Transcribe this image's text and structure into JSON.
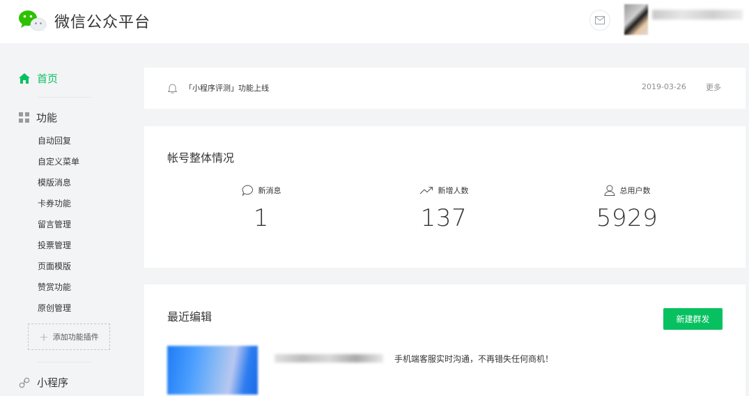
{
  "header": {
    "app_title": "微信公众平台"
  },
  "sidebar": {
    "home_label": "首页",
    "function_label": "功能",
    "function_items": [
      "自动回复",
      "自定义菜单",
      "模版消息",
      "卡券功能",
      "留言管理",
      "投票管理",
      "页面模版",
      "赞赏功能",
      "原创管理"
    ],
    "add_plugin_label": "添加功能插件",
    "mini_program_label": "小程序"
  },
  "notice": {
    "text": "「小程序评测」功能上线",
    "date": "2019-03-26",
    "more_label": "更多"
  },
  "overview": {
    "title": "帐号整体情况",
    "stats": [
      {
        "label": "新消息",
        "value": "1",
        "icon": "chat-bubble-icon"
      },
      {
        "label": "新增人数",
        "value": "137",
        "icon": "trend-up-icon"
      },
      {
        "label": "总用户数",
        "value": "5929",
        "icon": "user-icon"
      }
    ]
  },
  "recent": {
    "title": "最近编辑",
    "new_button_label": "新建群发",
    "item_description": "手机端客服实时沟通，不再错失任何商机！"
  },
  "colors": {
    "brand_green": "#07c160",
    "background": "#f3f4f6",
    "card": "#ffffff"
  }
}
